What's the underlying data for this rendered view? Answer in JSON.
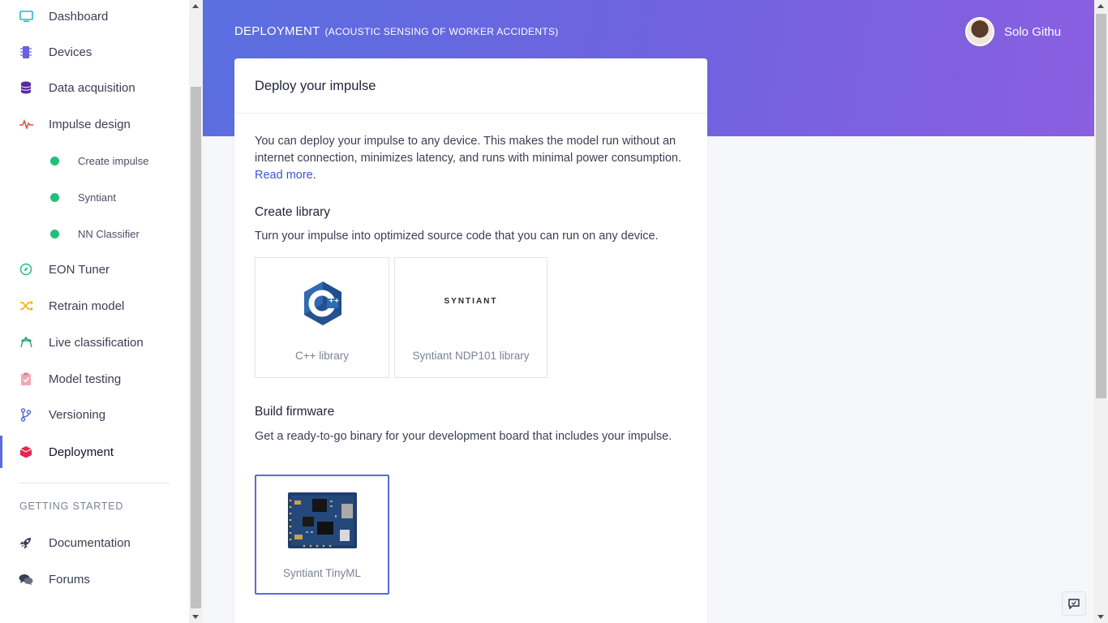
{
  "sidebar": {
    "items": [
      {
        "label": "Dashboard",
        "icon": "monitor-icon"
      },
      {
        "label": "Devices",
        "icon": "chip-icon"
      },
      {
        "label": "Data acquisition",
        "icon": "database-icon"
      },
      {
        "label": "Impulse design",
        "icon": "pulse-icon"
      },
      {
        "label": "EON Tuner",
        "icon": "compass-icon"
      },
      {
        "label": "Retrain model",
        "icon": "shuffle-icon"
      },
      {
        "label": "Live classification",
        "icon": "graph-icon"
      },
      {
        "label": "Model testing",
        "icon": "clipboard-check-icon"
      },
      {
        "label": "Versioning",
        "icon": "branch-icon"
      },
      {
        "label": "Deployment",
        "icon": "box-icon"
      }
    ],
    "sub_items": [
      {
        "label": "Create impulse"
      },
      {
        "label": "Syntiant"
      },
      {
        "label": "NN Classifier"
      }
    ],
    "section_heading": "GETTING STARTED",
    "getting_started": [
      {
        "label": "Documentation",
        "icon": "rocket-icon"
      },
      {
        "label": "Forums",
        "icon": "chat-bubbles-icon"
      }
    ],
    "active": "Deployment"
  },
  "header": {
    "title": "DEPLOYMENT",
    "subtitle": "(ACOUSTIC SENSING OF WORKER ACCIDENTS)",
    "user_name": "Solo Githu"
  },
  "card": {
    "title": "Deploy your impulse",
    "intro": "You can deploy your impulse to any device. This makes the model run without an internet connection, minimizes latency, and runs with minimal power consumption.",
    "read_more": "Read more",
    "library": {
      "title": "Create library",
      "description": "Turn your impulse into optimized source code that you can run on any device.",
      "options": [
        {
          "label": "C++ library",
          "logo": "cpp-logo"
        },
        {
          "label": "Syntiant NDP101 library",
          "logo_text": "SYNTIANT"
        }
      ]
    },
    "firmware": {
      "title": "Build firmware",
      "description": "Get a ready-to-go binary for your development board that includes your impulse.",
      "options": [
        {
          "label": "Syntiant TinyML",
          "selected": true
        }
      ]
    }
  },
  "colors": {
    "accent": "#5a6bdf",
    "banner_start": "#5a6fe0",
    "banner_end": "#8a5fe0",
    "status_green": "#21c07a",
    "link": "#3f56c4"
  }
}
